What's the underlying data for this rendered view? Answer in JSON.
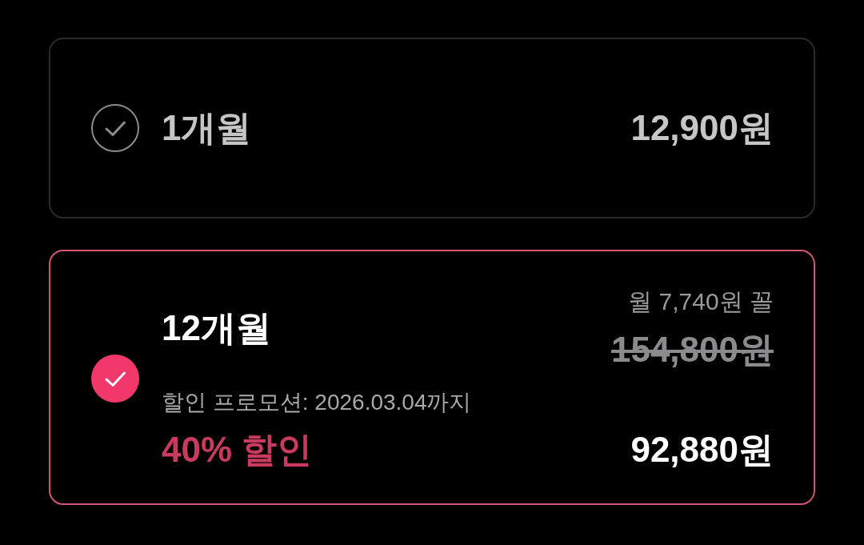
{
  "plans": [
    {
      "name": "1개월",
      "price": "12,900원",
      "selected": false
    },
    {
      "name": "12개월",
      "promo_period": "할인 프로모션: 2026.03.04까지",
      "discount": "40% 할인",
      "monthly_note": "월 7,740원 꼴",
      "original_price": "154,800원",
      "price": "92,880원",
      "selected": true
    }
  ]
}
